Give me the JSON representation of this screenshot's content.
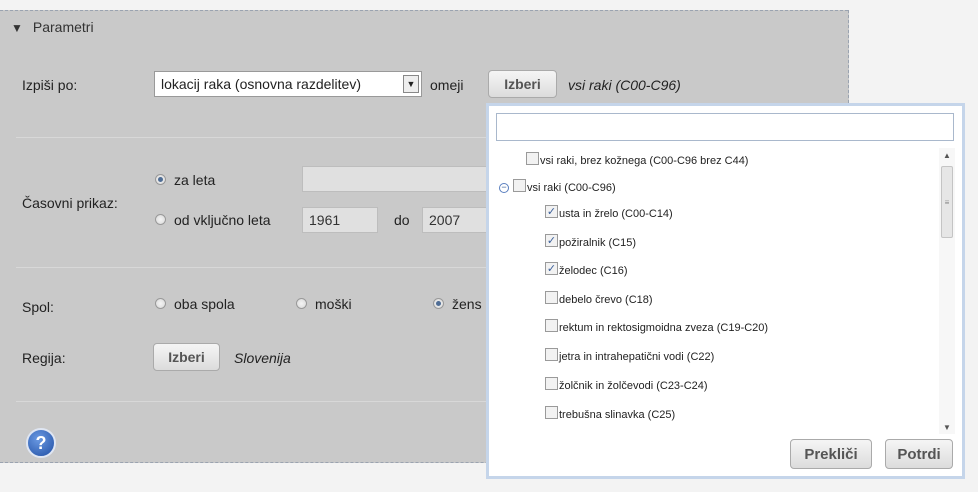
{
  "section": {
    "title": "Parametri"
  },
  "izpisi": {
    "label": "Izpiši po:",
    "select_value": "lokacij raka (osnovna razdelitev)",
    "omeji": "omeji",
    "button": "Izberi",
    "selection": "vsi raki (C00-C96)"
  },
  "casovni": {
    "label": "Časovni prikaz:",
    "za_leta": "za leta",
    "od_label": "od vključno leta",
    "from_value": "1961",
    "do_label": "do",
    "to_value": "2007"
  },
  "spol": {
    "label": "Spol:",
    "options": [
      "oba spola",
      "moški",
      "žens"
    ]
  },
  "regija": {
    "label": "Regija:",
    "button": "Izberi",
    "value": "Slovenija"
  },
  "help": {
    "icon": "question-icon",
    "glyph": "?"
  },
  "popup": {
    "search_value": "",
    "items": [
      "vsi raki, brez kožnega (C00-C96 brez C44)",
      "vsi raki (C00-C96)",
      "usta in žrelo (C00-C14)",
      "požiralnik (C15)",
      "želodec (C16)",
      "debelo črevo (C18)",
      "rektum in rektosigmoidna zveza (C19-C20)",
      "jetra in intrahepatični vodi (C22)",
      "žolčnik in žolčevodi (C23-C24)",
      "trebušna slinavka (C25)"
    ],
    "checked": [
      false,
      false,
      true,
      true,
      true,
      false,
      false,
      false,
      false,
      false
    ],
    "cancel_button": "Prekliči",
    "confirm_button": "Potrdi"
  },
  "colors": {
    "panel": "#c9c9c9",
    "popup_border": "#c5d5ea",
    "help": "#1f4ea3"
  }
}
